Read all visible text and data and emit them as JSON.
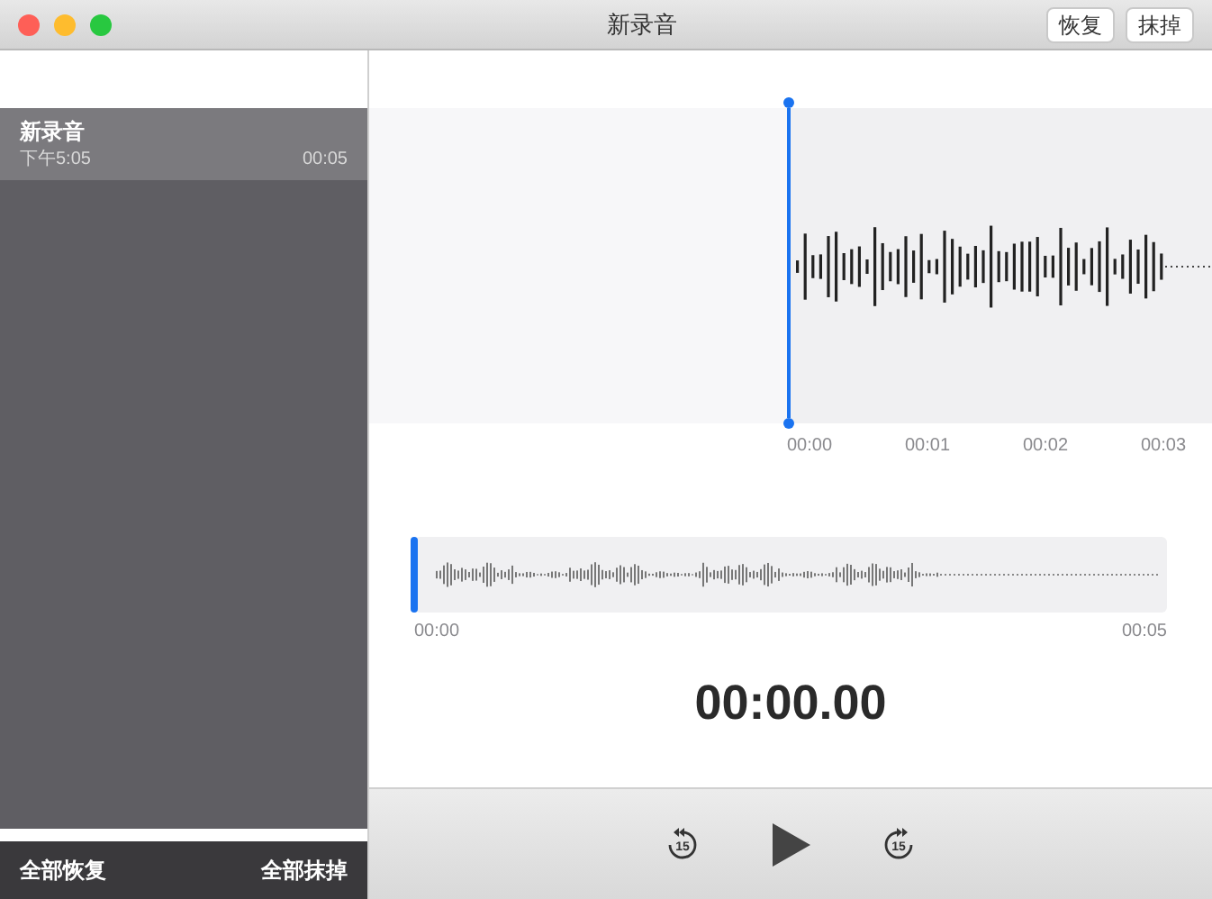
{
  "window": {
    "title": "新录音"
  },
  "toolbar_buttons": [
    "恢复",
    "抹掉"
  ],
  "recordings": [
    {
      "name": "新录音",
      "time": "下午5:05",
      "duration": "00:05",
      "selected": true
    }
  ],
  "timeline_ticks": [
    "00:00",
    "00:01",
    "00:02",
    "00:03"
  ],
  "overview": {
    "start": "00:00",
    "end": "00:05",
    "level": 0
  },
  "elapsed": "00:00.00",
  "controls": {
    "skip_back": "15",
    "skip_forward": "15"
  },
  "footer": {
    "left": "全部恢复",
    "right": "全部抹掉"
  }
}
